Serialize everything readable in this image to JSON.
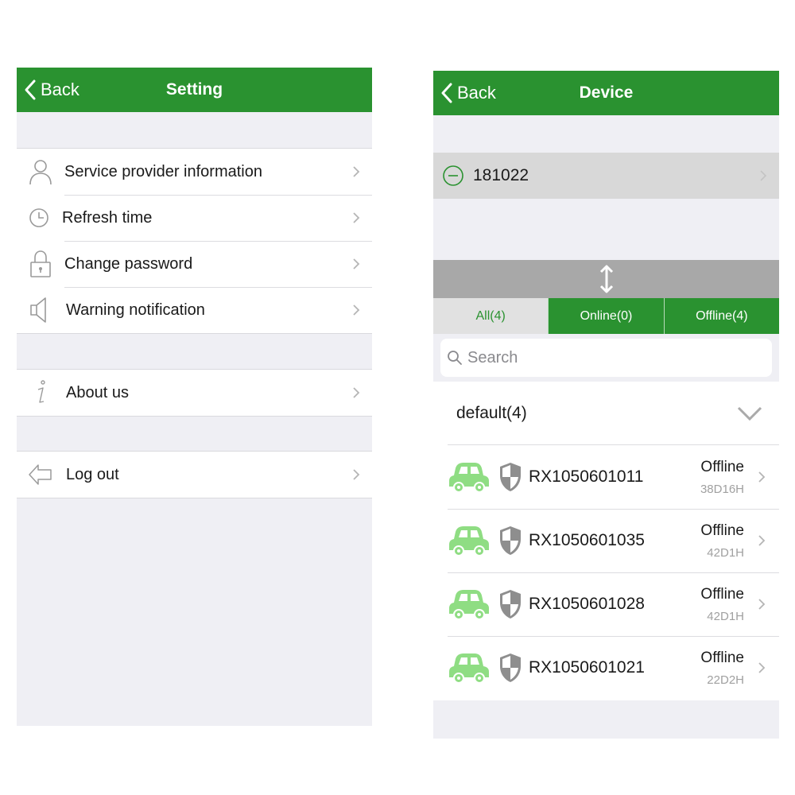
{
  "settings": {
    "back_label": "Back",
    "title": "Setting",
    "items": [
      {
        "label": "Service provider information",
        "icon": "person-icon"
      },
      {
        "label": "Refresh time",
        "icon": "clock-icon"
      },
      {
        "label": "Change password",
        "icon": "lock-icon"
      },
      {
        "label": "Warning notification",
        "icon": "speaker-icon"
      }
    ],
    "about_label": "About us",
    "logout_label": "Log out"
  },
  "device": {
    "back_label": "Back",
    "title": "Device",
    "selected_device": "181022",
    "tabs": [
      {
        "label": "All(4)",
        "active": true
      },
      {
        "label": "Online(0)",
        "active": false
      },
      {
        "label": "Offline(4)",
        "active": false
      }
    ],
    "search_placeholder": "Search",
    "group_name": "default(4)",
    "devices": [
      {
        "id": "RX1050601011",
        "status": "Offline",
        "duration": "38D16H"
      },
      {
        "id": "RX1050601035",
        "status": "Offline",
        "duration": "42D1H"
      },
      {
        "id": "RX1050601028",
        "status": "Offline",
        "duration": "42D1H"
      },
      {
        "id": "RX1050601021",
        "status": "Offline",
        "duration": "22D2H"
      }
    ]
  },
  "colors": {
    "brand_green": "#2a9230",
    "car_green": "#8fdd83",
    "background": "#efeff4"
  }
}
